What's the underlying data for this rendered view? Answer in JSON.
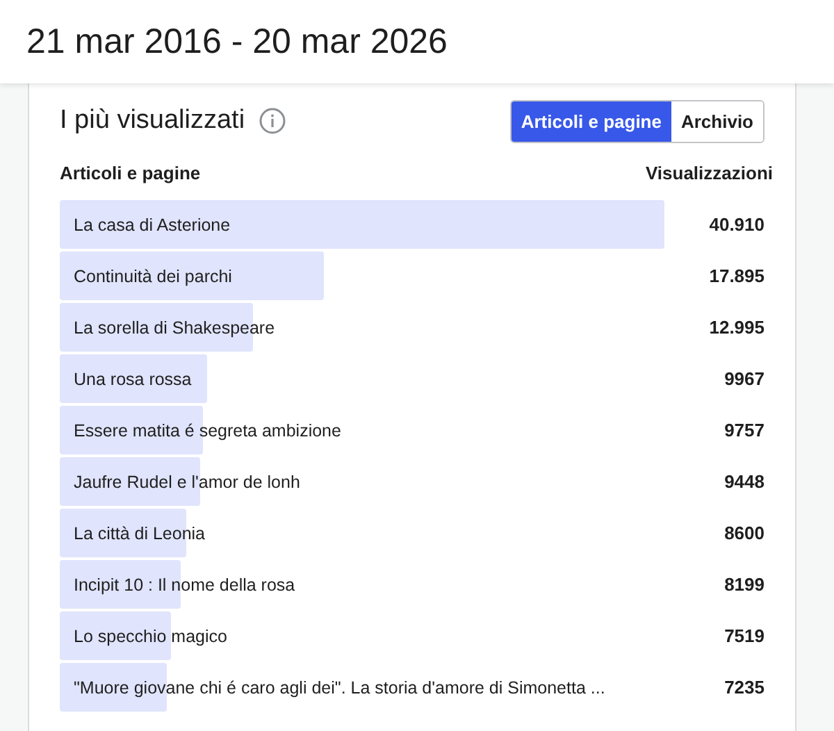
{
  "period": "21 mar 2016 - 20 mar 2026",
  "panel": {
    "title": "I più visualizzati",
    "toggle": [
      {
        "label": "Articoli e pagine",
        "selected": true
      },
      {
        "label": "Archivio",
        "selected": false
      }
    ],
    "columns": [
      "Articoli e pagine",
      "Visualizzazioni"
    ],
    "rows": [
      {
        "title": "La casa di Asterione",
        "views": "40.910"
      },
      {
        "title": "Continuità dei parchi",
        "views": "17.895"
      },
      {
        "title": "La sorella di Shakespeare",
        "views": "12.995"
      },
      {
        "title": "Una rosa rossa",
        "views": "9967"
      },
      {
        "title": "Essere matita é segreta ambizione",
        "views": "9757"
      },
      {
        "title": "Jaufre Rudel e l'amor de lonh",
        "views": "9448"
      },
      {
        "title": "La città di Leonia",
        "views": "8600"
      },
      {
        "title": "Incipit 10 : Il nome della rosa",
        "views": "8199"
      },
      {
        "title": "Lo specchio magico",
        "views": "7519"
      },
      {
        "title": "\"Muore giovane chi é caro agli dei\". La storia d'amore di Simonetta ...",
        "views": "7235"
      }
    ]
  }
}
